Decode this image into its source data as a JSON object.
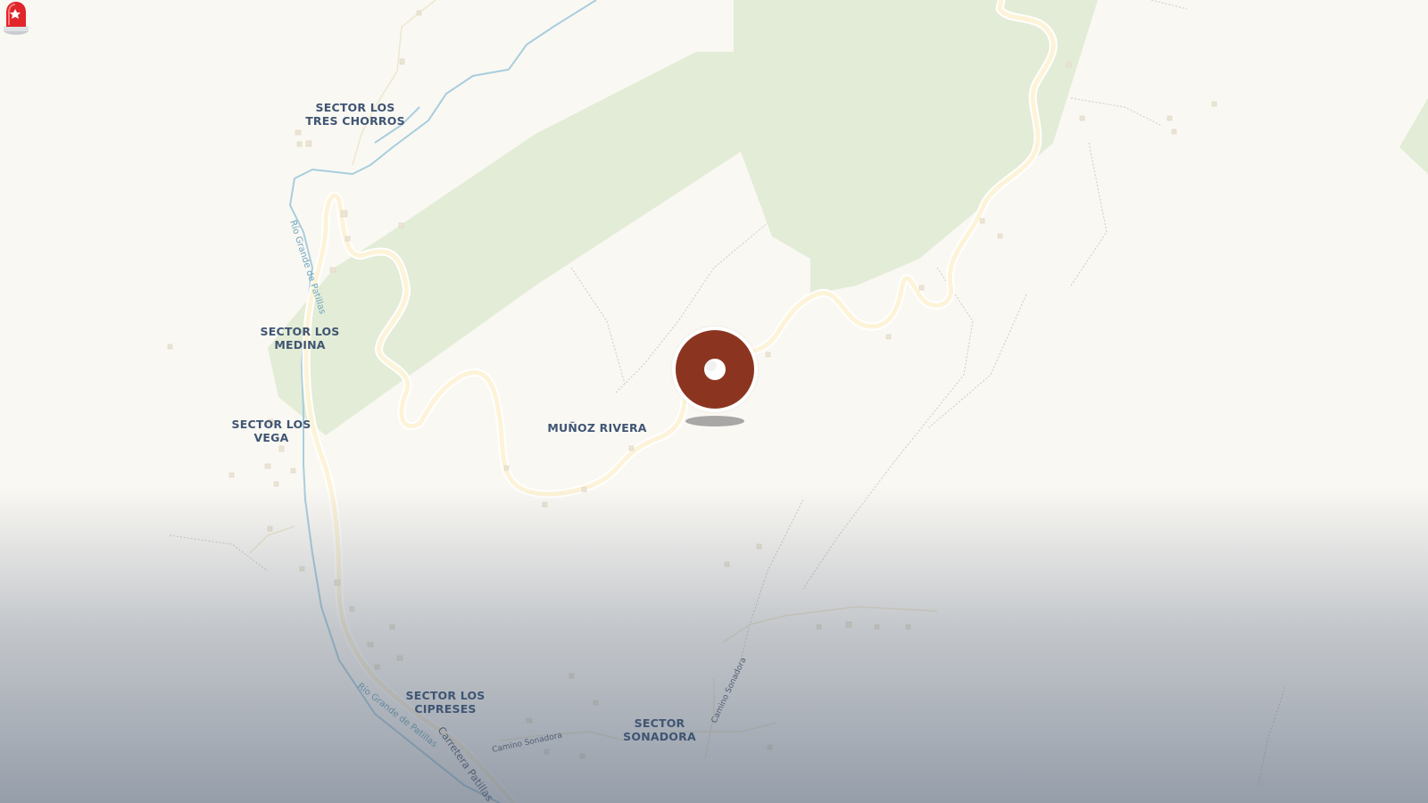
{
  "map": {
    "places": [
      {
        "id": "tres-chorros",
        "line1": "SECTOR LOS",
        "line2": "TRES CHORROS"
      },
      {
        "id": "medina",
        "line1": "SECTOR LOS",
        "line2": "MEDINA"
      },
      {
        "id": "vega",
        "line1": "SECTOR LOS",
        "line2": "VEGA"
      },
      {
        "id": "munoz-rivera",
        "line1": "MUÑOZ RIVERA",
        "line2": ""
      },
      {
        "id": "cipreses",
        "line1": "SECTOR LOS",
        "line2": "CIPRESES"
      },
      {
        "id": "sonadora",
        "line1": "SECTOR",
        "line2": "SONADORA"
      }
    ],
    "roads": {
      "river_upper": "Río Grande de Patillas",
      "river_lower": "Río Grande de Patillas",
      "carretera": "Carretera Patillas - C",
      "camino_sonadora_1": "Camino Sonadora",
      "camino_sonadora_2": "Camino Sonadora"
    },
    "marker": {
      "icon": "siren-icon",
      "color": "#8b3520"
    },
    "colors": {
      "land": "#faf8f3",
      "forest": "#e3ecd6",
      "road": "#fdf3d8",
      "water": "#a8cedd",
      "label": "#3f5573"
    }
  }
}
